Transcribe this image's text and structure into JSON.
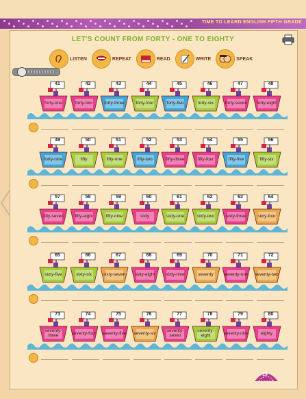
{
  "banner": {
    "text": "TIME TO LEARN ENGLISH FIFTH GRADE"
  },
  "title": "LET'S COUNT FROM FORTY - ONE TO EIGHTY",
  "modes": [
    {
      "label": "LISTEN",
      "icon": "ear-icon"
    },
    {
      "label": "REPEAT",
      "icon": "mouth-icon"
    },
    {
      "label": "READ",
      "icon": "book-icon"
    },
    {
      "label": "WRITE",
      "icon": "pencil-icon"
    },
    {
      "label": "SPEAK",
      "icon": "speaking-faces-icon"
    }
  ],
  "rows": [
    {
      "boats": [
        {
          "num": "41",
          "word": "forty-one",
          "color": "#e93f8e"
        },
        {
          "num": "42",
          "word": "forty-two",
          "color": "#e93f8e"
        },
        {
          "num": "43",
          "word": "forty-three",
          "color": "#3fa6d9"
        },
        {
          "num": "44",
          "word": "forty-four",
          "color": "#a4cd39"
        },
        {
          "num": "45",
          "word": "forty-five",
          "color": "#3fa6d9"
        },
        {
          "num": "46",
          "word": "forty-six",
          "color": "#a4cd39"
        },
        {
          "num": "47",
          "word": "forty-seven",
          "color": "#e93f8e"
        },
        {
          "num": "48",
          "word": "forty-eight",
          "color": "#e93f8e"
        }
      ]
    },
    {
      "boats": [
        {
          "num": "49",
          "word": "forty-nine",
          "color": "#3fa6d9"
        },
        {
          "num": "50",
          "word": "fifty",
          "color": "#a4cd39"
        },
        {
          "num": "51",
          "word": "fifty-one",
          "color": "#a4cd39"
        },
        {
          "num": "52",
          "word": "fifty-two",
          "color": "#3fa6d9"
        },
        {
          "num": "53",
          "word": "fifty-three",
          "color": "#e93f8e"
        },
        {
          "num": "54",
          "word": "fifty-four",
          "color": "#e93f8e"
        },
        {
          "num": "55",
          "word": "fifty-five",
          "color": "#3fa6d9"
        },
        {
          "num": "56",
          "word": "fifty-six",
          "color": "#a4cd39"
        }
      ]
    },
    {
      "boats": [
        {
          "num": "57",
          "word": "fifty-seven",
          "color": "#e93f8e"
        },
        {
          "num": "58",
          "word": "fifty-eight",
          "color": "#e93f8e"
        },
        {
          "num": "59",
          "word": "fifty-nine",
          "color": "#a4cd39"
        },
        {
          "num": "60",
          "word": "sixty",
          "color": "#e93f8e"
        },
        {
          "num": "61",
          "word": "sixty-one",
          "color": "#a4cd39"
        },
        {
          "num": "62",
          "word": "sixty-two",
          "color": "#a4cd39"
        },
        {
          "num": "63",
          "word": "sixty-three",
          "color": "#e93f8e"
        },
        {
          "num": "64",
          "word": "sixty-four",
          "color": "#e9a94a"
        }
      ]
    },
    {
      "boats": [
        {
          "num": "65",
          "word": "sixty-five",
          "color": "#a4cd39"
        },
        {
          "num": "66",
          "word": "sixty-six",
          "color": "#a4cd39"
        },
        {
          "num": "67",
          "word": "sixty-seven",
          "color": "#e9a94a"
        },
        {
          "num": "68",
          "word": "sixty-eight",
          "color": "#e93f8e"
        },
        {
          "num": "69",
          "word": "sixty-nine",
          "color": "#e93f8e"
        },
        {
          "num": "70",
          "word": "seventy",
          "color": "#e9a94a"
        },
        {
          "num": "71",
          "word": "seventy-one",
          "color": "#e93f8e"
        },
        {
          "num": "72",
          "word": "seventy-two",
          "color": "#e9a94a"
        }
      ]
    },
    {
      "boats": [
        {
          "num": "73",
          "word": "seventy-three",
          "color": "#e93f8e"
        },
        {
          "num": "74",
          "word": "seventy-four",
          "color": "#e93f8e"
        },
        {
          "num": "75",
          "word": "seventy-five",
          "color": "#e93f8e"
        },
        {
          "num": "76",
          "word": "seventy-six",
          "color": "#e9a94a"
        },
        {
          "num": "77",
          "word": "seventy-seven",
          "color": "#e93f8e"
        },
        {
          "num": "78",
          "word": "seventy-eight",
          "color": "#a4cd39"
        },
        {
          "num": "79",
          "word": "seventy-nine",
          "color": "#e93f8e"
        },
        {
          "num": "80",
          "word": "eighty",
          "color": "#e93f8e"
        }
      ]
    }
  ],
  "page_number": "15",
  "colors": {
    "wave": "#5fb6d6",
    "flag": "#d6234a",
    "pole": "#7a4a2a",
    "banner": "#a54fa8",
    "title": "#7bb02b"
  }
}
